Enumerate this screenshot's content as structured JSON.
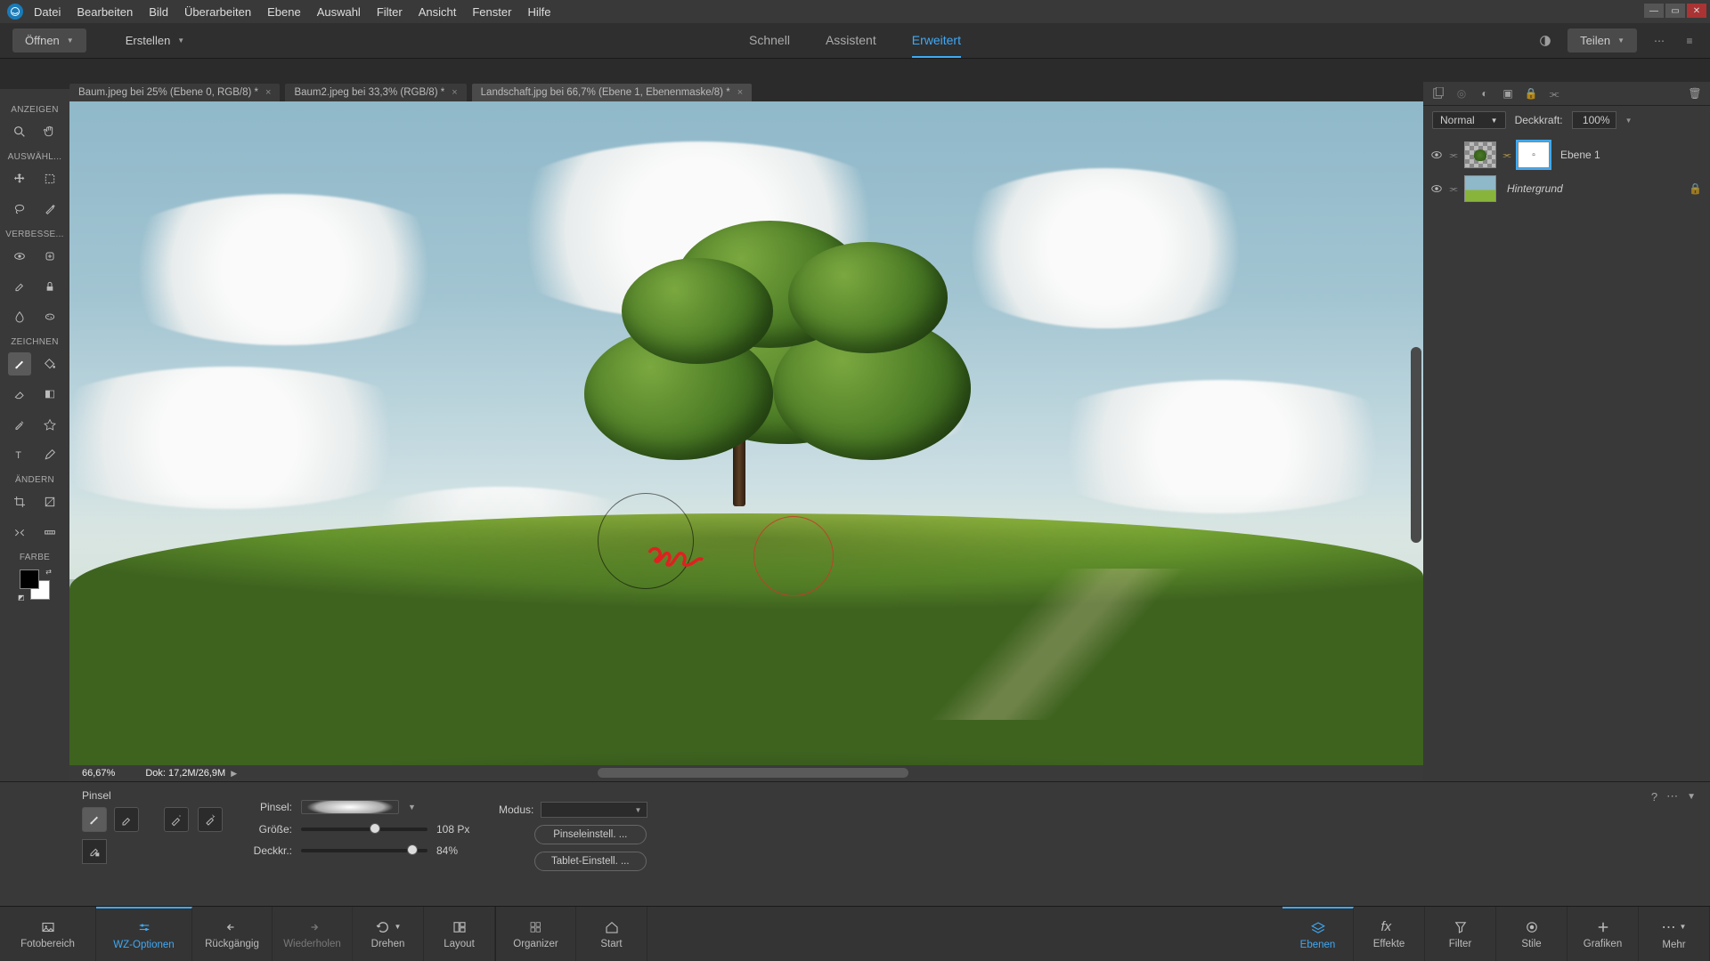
{
  "menu": {
    "items": [
      "Datei",
      "Bearbeiten",
      "Bild",
      "Überarbeiten",
      "Ebene",
      "Auswahl",
      "Filter",
      "Ansicht",
      "Fenster",
      "Hilfe"
    ]
  },
  "actionbar": {
    "open": "Öffnen",
    "create": "Erstellen",
    "share": "Teilen"
  },
  "modes": {
    "quick": "Schnell",
    "guided": "Assistent",
    "expert": "Erweitert"
  },
  "doctabs": [
    {
      "label": "Baum.jpeg bei 25% (Ebene 0, RGB/8) *"
    },
    {
      "label": "Baum2.jpeg bei 33,3% (RGB/8) *"
    },
    {
      "label": "Landschaft.jpg bei 66,7% (Ebene 1, Ebenenmaske/8) *"
    }
  ],
  "toolgroups": {
    "view": "ANZEIGEN",
    "select": "AUSWÄHL...",
    "enhance": "VERBESSE...",
    "draw": "ZEICHNEN",
    "modify": "ÄNDERN",
    "color": "FARBE"
  },
  "status": {
    "zoom": "66,67%",
    "doc_label": "Dok:",
    "doc": "17,2M/26,9M"
  },
  "layerspanel": {
    "blend_mode": "Normal",
    "opacity_label": "Deckkraft:",
    "opacity": "100%",
    "layers": [
      {
        "name": "Ebene 1",
        "mask": true,
        "selected": true
      },
      {
        "name": "Hintergrund",
        "italic": true,
        "locked": true
      }
    ]
  },
  "options": {
    "title": "Pinsel",
    "brush_label": "Pinsel:",
    "size_label": "Größe:",
    "size_val": "108 Px",
    "size_pct": 54,
    "opac_label": "Deckkr.:",
    "opac_val": "84%",
    "opac_pct": 84,
    "mode_label": "Modus:",
    "btn1": "Pinseleinstell. ...",
    "btn2": "Tablet-Einstell. ..."
  },
  "dock": {
    "left": [
      "Fotobereich",
      "WZ-Optionen",
      "Rückgängig",
      "Wiederholen",
      "Drehen",
      "Layout"
    ],
    "mid": [
      "Organizer",
      "Start"
    ],
    "right": [
      "Ebenen",
      "Effekte",
      "Filter",
      "Stile",
      "Grafiken",
      "Mehr"
    ]
  }
}
